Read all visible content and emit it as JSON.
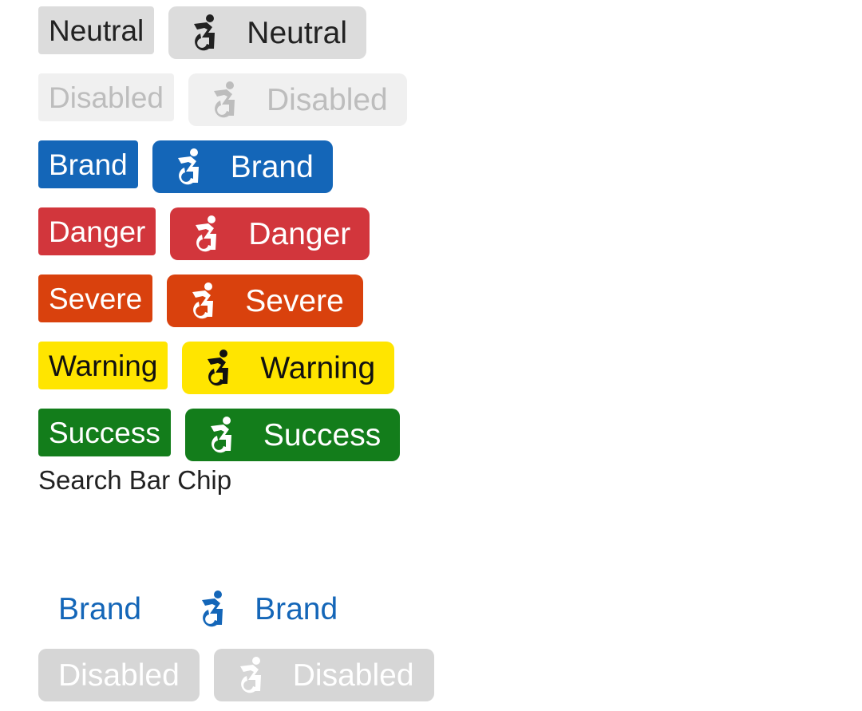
{
  "colors": {
    "neutral_bg": "#dcdcdc",
    "disabled_bg": "#f0f0f0",
    "brand": "#1466b8",
    "danger": "#d2363c",
    "severe": "#d9410d",
    "warning": "#ffe500",
    "success": "#137d1b",
    "searchbar_disabled_bg": "#d6d6d6"
  },
  "chips": [
    {
      "variant": "neutral",
      "label": "Neutral",
      "icon_label": "Neutral",
      "icon": "accessibility-icon"
    },
    {
      "variant": "disabled",
      "label": "Disabled",
      "icon_label": "Disabled",
      "icon": "accessibility-icon"
    },
    {
      "variant": "brand",
      "label": "Brand",
      "icon_label": "Brand",
      "icon": "accessibility-icon"
    },
    {
      "variant": "danger",
      "label": "Danger",
      "icon_label": "Danger",
      "icon": "accessibility-icon"
    },
    {
      "variant": "severe",
      "label": "Severe",
      "icon_label": "Severe",
      "icon": "accessibility-icon"
    },
    {
      "variant": "warning",
      "label": "Warning",
      "icon_label": "Warning",
      "icon": "accessibility-icon"
    },
    {
      "variant": "success",
      "label": "Success",
      "icon_label": "Success",
      "icon": "accessibility-icon"
    }
  ],
  "section_title": "Search Bar Chip",
  "search_bar_chips": [
    {
      "variant": "brand",
      "label": "Brand",
      "icon_label": "Brand",
      "icon": "accessibility-icon"
    },
    {
      "variant": "disabled",
      "label": "Disabled",
      "icon_label": "Disabled",
      "icon": "accessibility-icon"
    }
  ]
}
